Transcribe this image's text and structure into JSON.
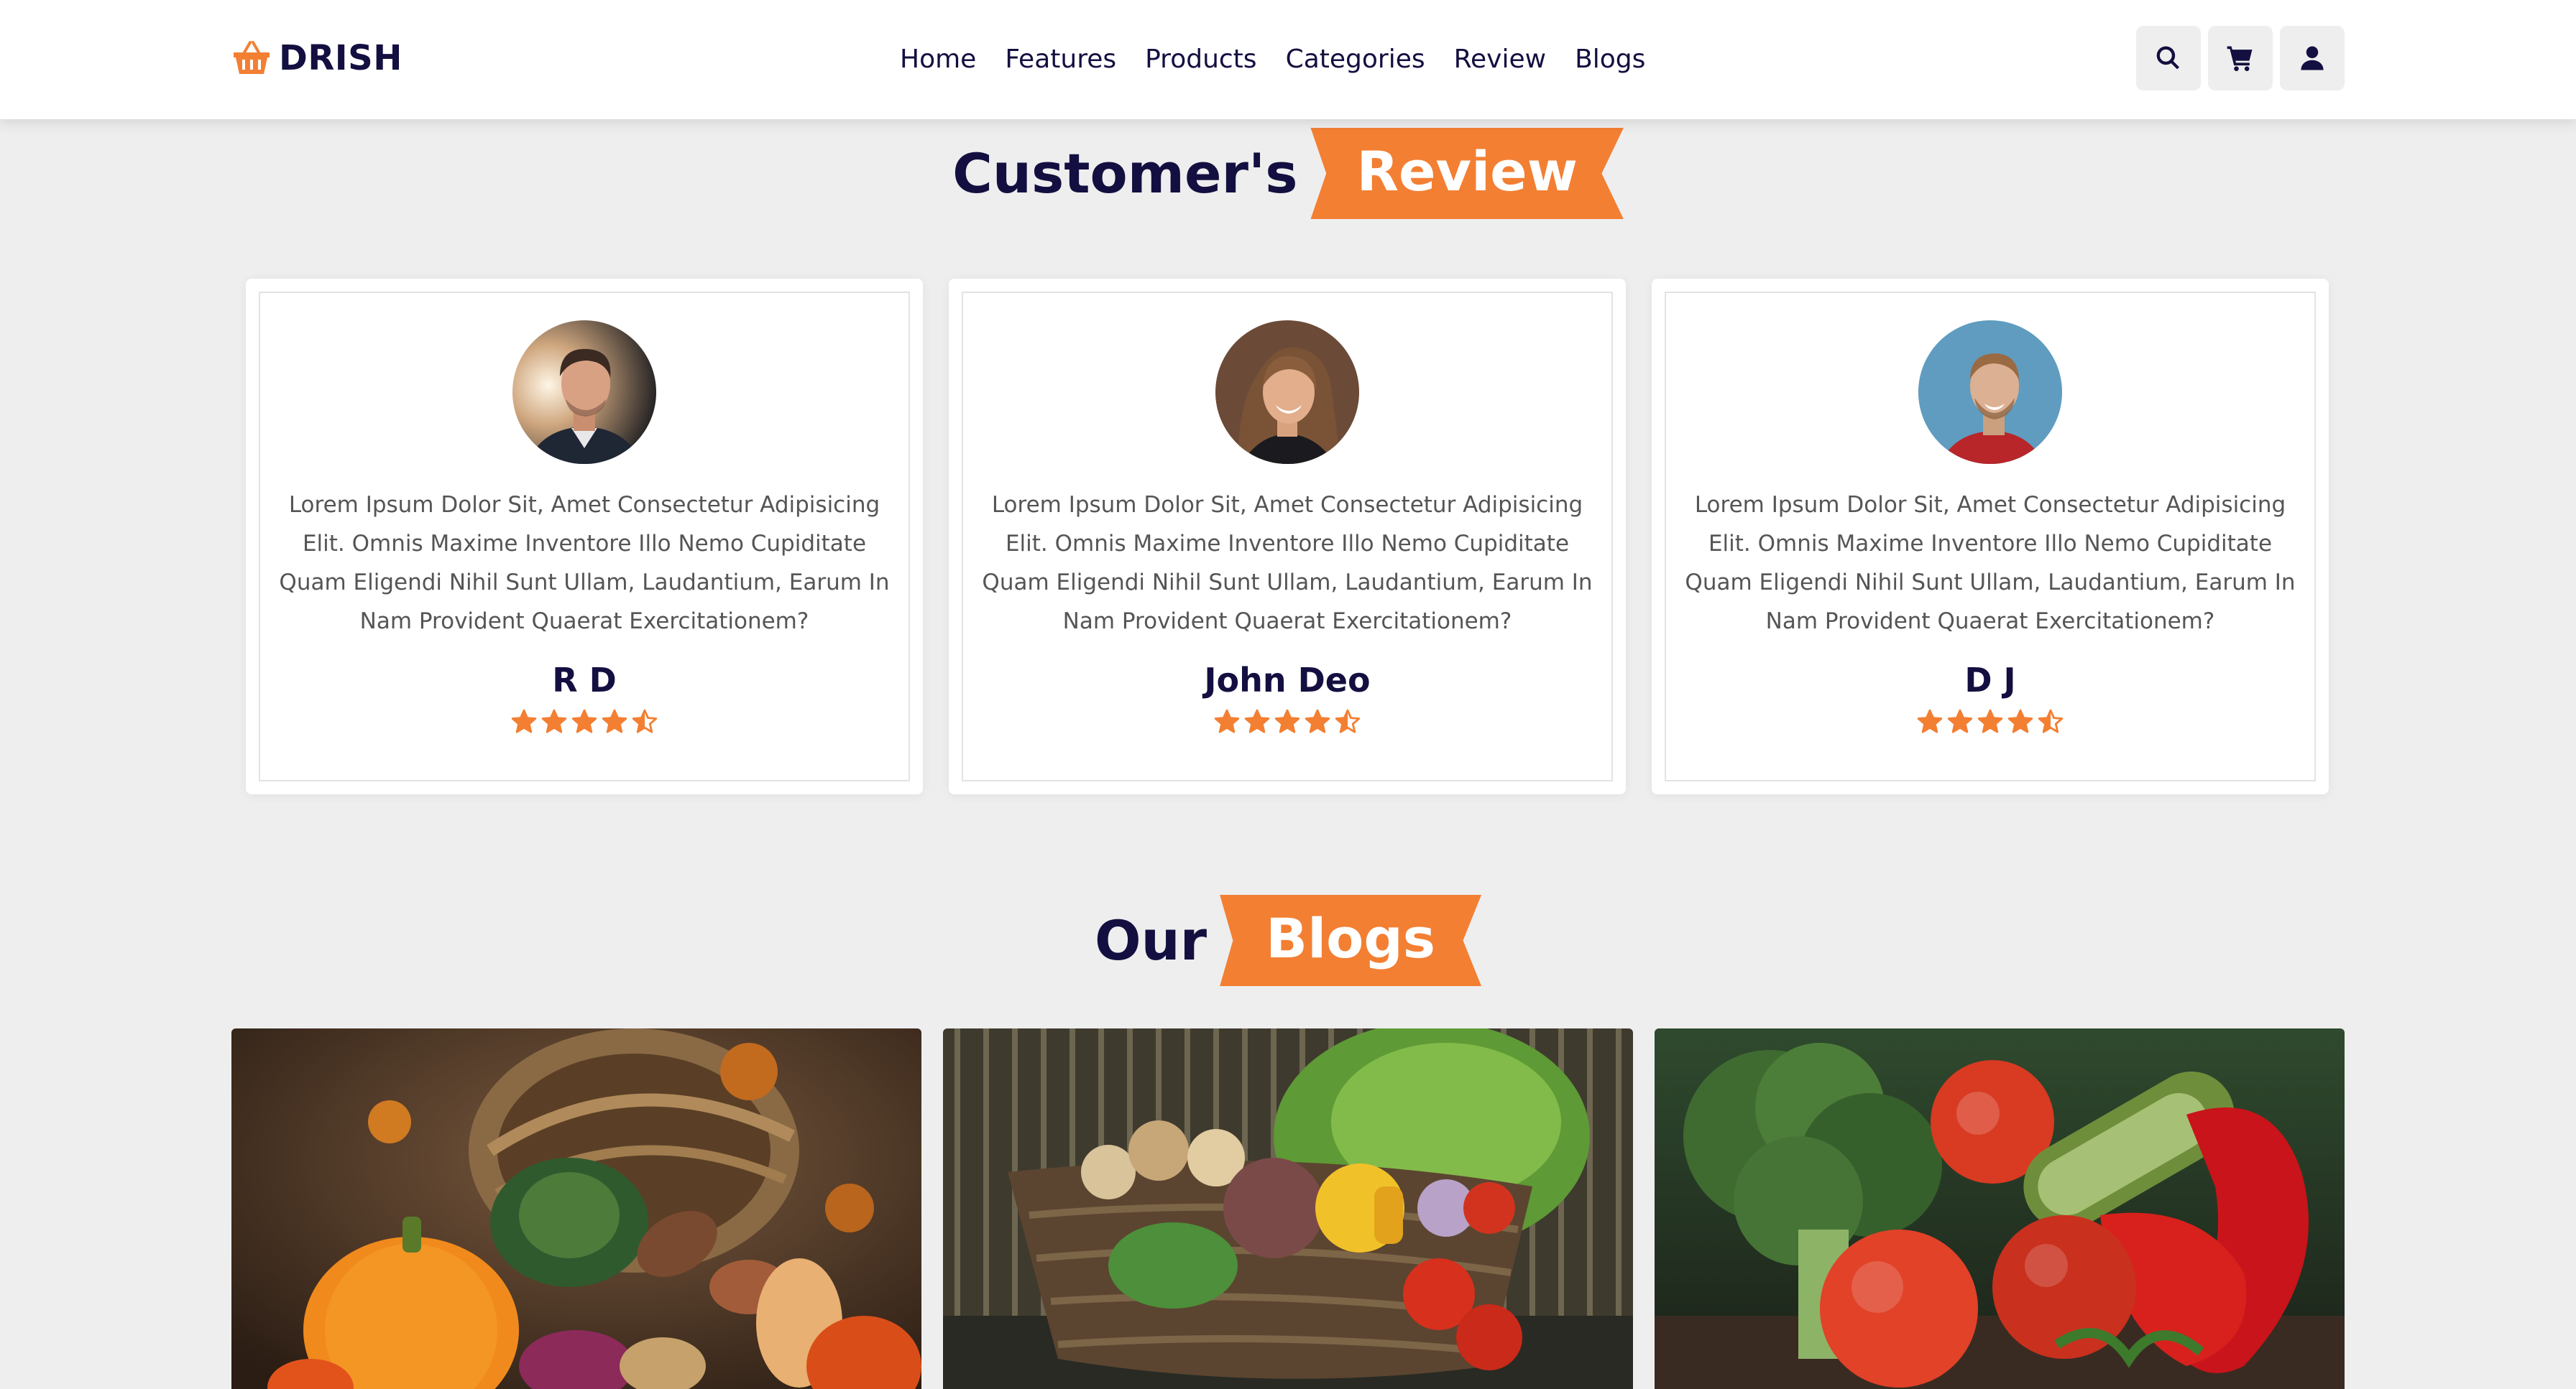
{
  "header": {
    "logo_text": "DRISH",
    "logo_icon": "basket-icon",
    "nav": [
      "Home",
      "Features",
      "Products",
      "Categories",
      "Review",
      "Blogs"
    ],
    "icons": [
      "search-icon",
      "cart-icon",
      "user-icon"
    ]
  },
  "colors": {
    "accent": "#f37f33",
    "heading": "#130f40",
    "background": "#eeeeee",
    "card": "#ffffff"
  },
  "review_section": {
    "title_plain": "Customer's",
    "title_highlight": "Review",
    "reviews": [
      {
        "text": "Lorem Ipsum Dolor Sit, Amet Consectetur Adipisicing Elit. Omnis Maxime Inventore Illo Nemo Cupiditate Quam Eligendi Nihil Sunt Ullam, Laudantium, Earum In Nam Provident Quaerat Exercitationem?",
        "name": "R D",
        "rating": 4.5
      },
      {
        "text": "Lorem Ipsum Dolor Sit, Amet Consectetur Adipisicing Elit. Omnis Maxime Inventore Illo Nemo Cupiditate Quam Eligendi Nihil Sunt Ullam, Laudantium, Earum In Nam Provident Quaerat Exercitationem?",
        "name": "John Deo",
        "rating": 4.5
      },
      {
        "text": "Lorem Ipsum Dolor Sit, Amet Consectetur Adipisicing Elit. Omnis Maxime Inventore Illo Nemo Cupiditate Quam Eligendi Nihil Sunt Ullam, Laudantium, Earum In Nam Provident Quaerat Exercitationem?",
        "name": "D J",
        "rating": 4.5
      }
    ]
  },
  "blog_section": {
    "title_plain": "Our",
    "title_highlight": "Blogs"
  }
}
